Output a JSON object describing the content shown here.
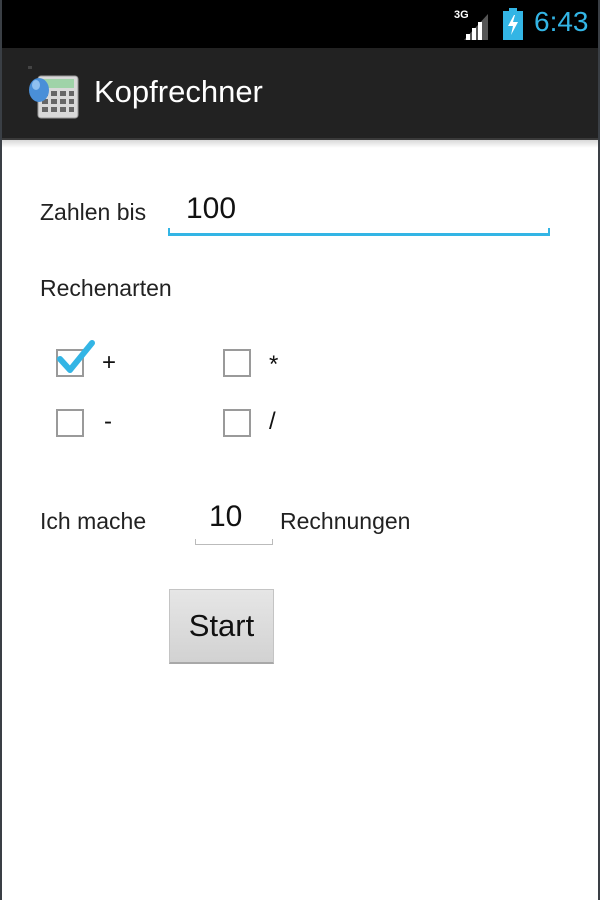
{
  "status_bar": {
    "network": "3G",
    "time": "6:43",
    "signal_icon": "signal-bars-icon",
    "battery_icon": "battery-charging-icon",
    "accent_color": "#33b5e5"
  },
  "action_bar": {
    "app_icon": "calculator-icon",
    "title": "Kopfrechner",
    "background": "#222222"
  },
  "form": {
    "range_label": "Zahlen bis",
    "range_value": "100",
    "operations_label": "Rechenarten",
    "operations": [
      {
        "symbol": "+",
        "checked": true
      },
      {
        "symbol": "*",
        "checked": false
      },
      {
        "symbol": "-",
        "checked": false
      },
      {
        "symbol": "/",
        "checked": false
      }
    ],
    "count_prefix": "Ich mache",
    "count_value": "10",
    "count_suffix": "Rechnungen",
    "start_label": "Start"
  }
}
